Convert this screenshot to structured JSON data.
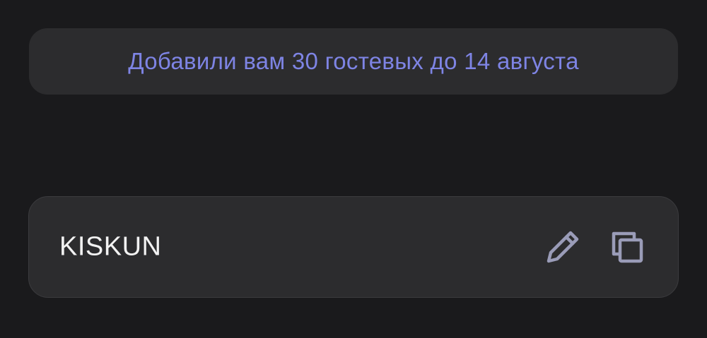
{
  "banner": {
    "text": "Добавили вам 30 гостевых до 14 августа",
    "text_color": "#7e84e4"
  },
  "promo": {
    "code": "KISKUN",
    "edit_icon": "pencil-icon",
    "copy_icon": "copy-icon",
    "icon_color": "#9a9cb8"
  },
  "colors": {
    "background": "#1a1a1c",
    "card": "#2c2c2e"
  }
}
